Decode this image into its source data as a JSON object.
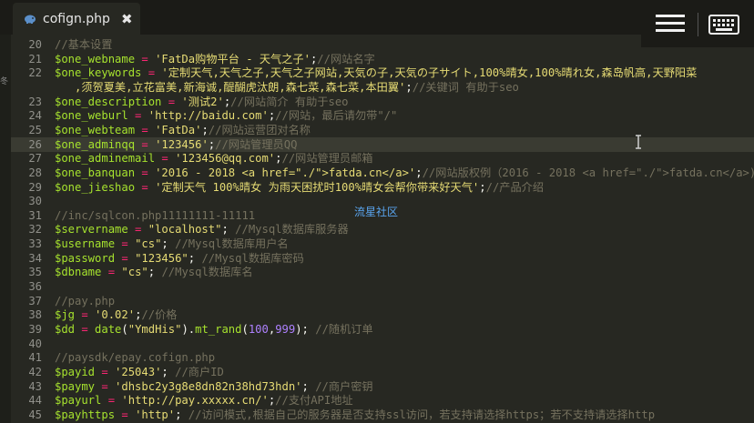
{
  "tab": {
    "title": "cofign.php",
    "file_icon": "elephant-php-icon",
    "close_icon": "close-icon"
  },
  "toolbar": {
    "menu_icon": "hamburger-menu-icon",
    "keyboard_icon": "keyboard-icon"
  },
  "colors": {
    "background": "#272822",
    "variable": "#a6e22e",
    "string": "#e6db74",
    "comment": "#75715e",
    "operator": "#f92672",
    "number": "#ae81ff",
    "line_number": "#90908a"
  },
  "left_strip_text": "冬",
  "watermark": "流星社区",
  "current_line": "26",
  "lines": [
    {
      "n": "20",
      "tokens": [
        {
          "t": "cmt",
          "v": "//基本设置"
        }
      ]
    },
    {
      "n": "21",
      "tokens": [
        {
          "t": "var",
          "v": "$one_webname"
        },
        {
          "t": "op",
          "v": " = "
        },
        {
          "t": "str",
          "v": "'FatDa购物平台 - 天气之子'"
        },
        {
          "t": "plain",
          "v": ";"
        },
        {
          "t": "cmt",
          "v": "//网站名字"
        }
      ]
    },
    {
      "n": "22",
      "tokens": [
        {
          "t": "var",
          "v": "$one_keywords"
        },
        {
          "t": "op",
          "v": " = "
        },
        {
          "t": "str",
          "v": "'定制天气,天气之子,天气之子网站,天気の子,天気の子サイト,100%晴女,100%晴れ女,森岛帆高,天野阳菜"
        }
      ]
    },
    {
      "n": "",
      "tokens": [
        {
          "t": "str",
          "v": "   ,须贺夏美,立花富美,新海诚,醍醐虎汰朗,森七菜,森七菜,本田翼'"
        },
        {
          "t": "plain",
          "v": ";"
        },
        {
          "t": "cmt",
          "v": "//关键词 有助于seo"
        }
      ]
    },
    {
      "n": "23",
      "tokens": [
        {
          "t": "var",
          "v": "$one_description"
        },
        {
          "t": "op",
          "v": " = "
        },
        {
          "t": "str",
          "v": "'测试2'"
        },
        {
          "t": "plain",
          "v": ";"
        },
        {
          "t": "cmt",
          "v": "//网站简介 有助于seo"
        }
      ]
    },
    {
      "n": "24",
      "tokens": [
        {
          "t": "var",
          "v": "$one_weburl"
        },
        {
          "t": "op",
          "v": " = "
        },
        {
          "t": "str",
          "v": "'http://baidu.com'"
        },
        {
          "t": "plain",
          "v": ";"
        },
        {
          "t": "cmt",
          "v": "//网站，最后请勿带\"/\""
        }
      ]
    },
    {
      "n": "25",
      "tokens": [
        {
          "t": "var",
          "v": "$one_webteam"
        },
        {
          "t": "op",
          "v": " = "
        },
        {
          "t": "str",
          "v": "'FatDa'"
        },
        {
          "t": "plain",
          "v": ";"
        },
        {
          "t": "cmt",
          "v": "//网站运营团对名称"
        }
      ]
    },
    {
      "n": "26",
      "tokens": [
        {
          "t": "var",
          "v": "$one_adminqq"
        },
        {
          "t": "op",
          "v": " = "
        },
        {
          "t": "str",
          "v": "'123456'"
        },
        {
          "t": "plain",
          "v": ";"
        },
        {
          "t": "cmt",
          "v": "//网站管理员QQ"
        }
      ]
    },
    {
      "n": "27",
      "tokens": [
        {
          "t": "var",
          "v": "$one_adminemail"
        },
        {
          "t": "op",
          "v": " = "
        },
        {
          "t": "str",
          "v": "'123456@qq.com'"
        },
        {
          "t": "plain",
          "v": ";"
        },
        {
          "t": "cmt",
          "v": "//网站管理员邮箱"
        }
      ]
    },
    {
      "n": "28",
      "tokens": [
        {
          "t": "var",
          "v": "$one_banquan"
        },
        {
          "t": "op",
          "v": " = "
        },
        {
          "t": "str",
          "v": "'2016 - 2018 <a href=\"./\">fatda.cn</a>'"
        },
        {
          "t": "plain",
          "v": ";"
        },
        {
          "t": "cmt",
          "v": "//网站版权例（2016 - 2018 <a href=\"./\">fatda.cn</a>)"
        }
      ]
    },
    {
      "n": "29",
      "tokens": [
        {
          "t": "var",
          "v": "$one_jieshao"
        },
        {
          "t": "op",
          "v": " = "
        },
        {
          "t": "str",
          "v": "'定制天气 100%晴女 为雨天困扰时100%晴女会帮你带来好天气'"
        },
        {
          "t": "plain",
          "v": ";"
        },
        {
          "t": "cmt",
          "v": "//产品介绍"
        }
      ]
    },
    {
      "n": "30",
      "tokens": []
    },
    {
      "n": "31",
      "tokens": [
        {
          "t": "cmt",
          "v": "//inc/sqlcon.php11111111-11111"
        }
      ]
    },
    {
      "n": "32",
      "tokens": [
        {
          "t": "var",
          "v": "$servername"
        },
        {
          "t": "op",
          "v": " = "
        },
        {
          "t": "str",
          "v": "\"localhost\""
        },
        {
          "t": "plain",
          "v": "; "
        },
        {
          "t": "cmt",
          "v": "//Mysql数据库服务器"
        }
      ]
    },
    {
      "n": "33",
      "tokens": [
        {
          "t": "var",
          "v": "$username"
        },
        {
          "t": "op",
          "v": " = "
        },
        {
          "t": "str",
          "v": "\"cs\""
        },
        {
          "t": "plain",
          "v": "; "
        },
        {
          "t": "cmt",
          "v": "//Mysql数据库用户名"
        }
      ]
    },
    {
      "n": "34",
      "tokens": [
        {
          "t": "var",
          "v": "$password"
        },
        {
          "t": "op",
          "v": " = "
        },
        {
          "t": "str",
          "v": "\"123456\""
        },
        {
          "t": "plain",
          "v": "; "
        },
        {
          "t": "cmt",
          "v": "//Mysql数据库密码"
        }
      ]
    },
    {
      "n": "35",
      "tokens": [
        {
          "t": "var",
          "v": "$dbname"
        },
        {
          "t": "op",
          "v": " = "
        },
        {
          "t": "str",
          "v": "\"cs\""
        },
        {
          "t": "plain",
          "v": "; "
        },
        {
          "t": "cmt",
          "v": "//Mysql数据库名"
        }
      ]
    },
    {
      "n": "36",
      "tokens": []
    },
    {
      "n": "37",
      "tokens": [
        {
          "t": "cmt",
          "v": "//pay.php"
        }
      ]
    },
    {
      "n": "38",
      "tokens": [
        {
          "t": "var",
          "v": "$jg"
        },
        {
          "t": "op",
          "v": " = "
        },
        {
          "t": "str",
          "v": "'0.02'"
        },
        {
          "t": "plain",
          "v": ";"
        },
        {
          "t": "cmt",
          "v": "//价格"
        }
      ]
    },
    {
      "n": "39",
      "tokens": [
        {
          "t": "var",
          "v": "$dd"
        },
        {
          "t": "op",
          "v": " = "
        },
        {
          "t": "fn",
          "v": "date"
        },
        {
          "t": "plain",
          "v": "("
        },
        {
          "t": "str",
          "v": "\"YmdHis\""
        },
        {
          "t": "plain",
          "v": ")."
        },
        {
          "t": "fn",
          "v": "mt_rand"
        },
        {
          "t": "plain",
          "v": "("
        },
        {
          "t": "num",
          "v": "100"
        },
        {
          "t": "plain",
          "v": ","
        },
        {
          "t": "num",
          "v": "999"
        },
        {
          "t": "plain",
          "v": "); "
        },
        {
          "t": "cmt",
          "v": "//随机订单"
        }
      ]
    },
    {
      "n": "40",
      "tokens": []
    },
    {
      "n": "41",
      "tokens": [
        {
          "t": "cmt",
          "v": "//paysdk/epay.cofign.php"
        }
      ]
    },
    {
      "n": "42",
      "tokens": [
        {
          "t": "var",
          "v": "$payid"
        },
        {
          "t": "op",
          "v": " = "
        },
        {
          "t": "str",
          "v": "'25043'"
        },
        {
          "t": "plain",
          "v": "; "
        },
        {
          "t": "cmt",
          "v": "//商户ID"
        }
      ]
    },
    {
      "n": "43",
      "tokens": [
        {
          "t": "var",
          "v": "$paymy"
        },
        {
          "t": "op",
          "v": " = "
        },
        {
          "t": "str",
          "v": "'dhsbc2y3g8e8dn82n38hd73hdn'"
        },
        {
          "t": "plain",
          "v": "; "
        },
        {
          "t": "cmt",
          "v": "//商户密钥"
        }
      ]
    },
    {
      "n": "44",
      "tokens": [
        {
          "t": "var",
          "v": "$payurl"
        },
        {
          "t": "op",
          "v": " = "
        },
        {
          "t": "str",
          "v": "'http://pay.xxxxx.cn/'"
        },
        {
          "t": "plain",
          "v": ";"
        },
        {
          "t": "cmt",
          "v": "//支付API地址"
        }
      ]
    },
    {
      "n": "45",
      "tokens": [
        {
          "t": "var",
          "v": "$payhttps"
        },
        {
          "t": "op",
          "v": " = "
        },
        {
          "t": "str",
          "v": "'http'"
        },
        {
          "t": "plain",
          "v": "; "
        },
        {
          "t": "cmt",
          "v": "//访问模式,根据自己的服务器是否支持ssl访问，若支持请选择https；若不支持请选择http"
        }
      ]
    }
  ]
}
